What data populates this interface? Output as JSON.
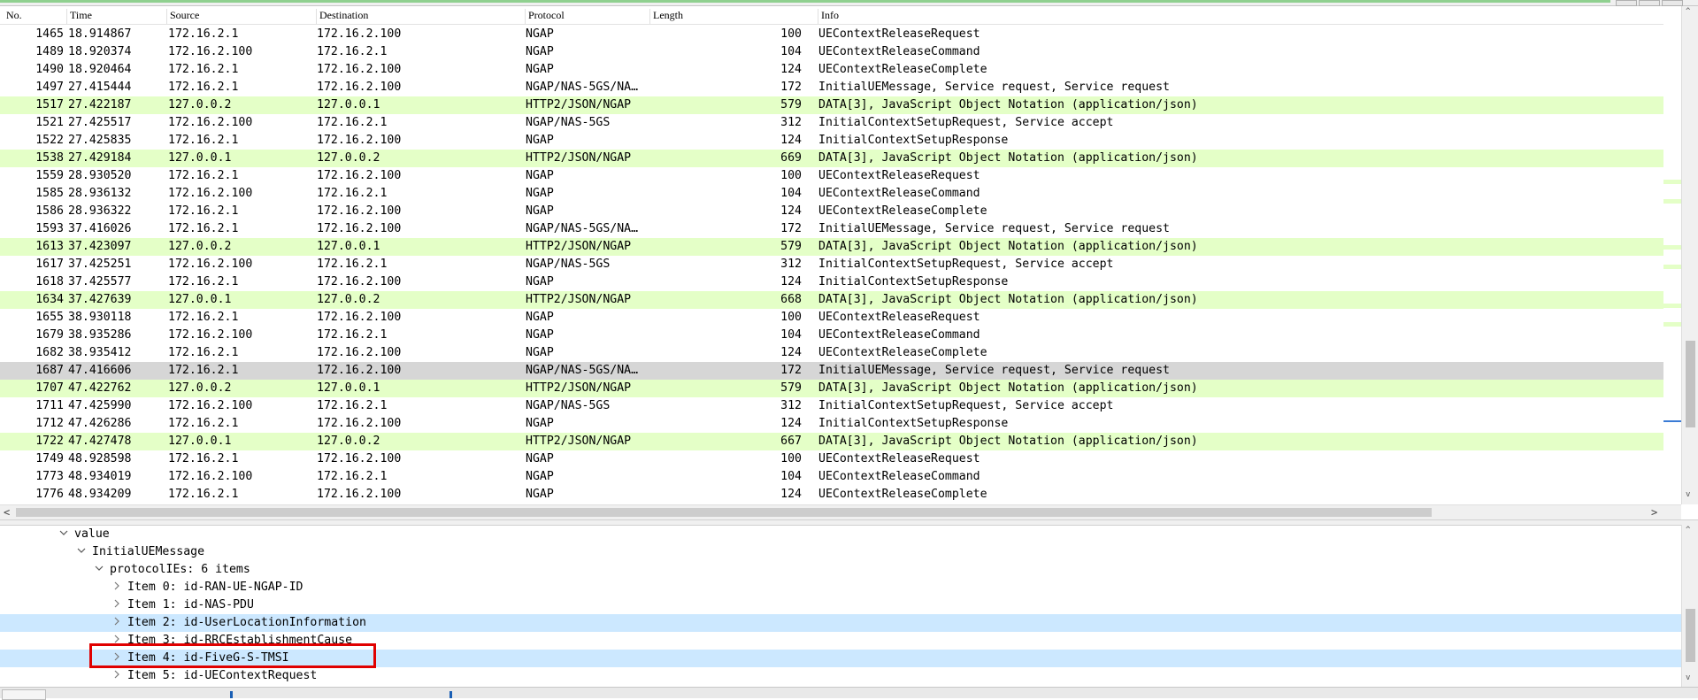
{
  "columns": {
    "no": "No.",
    "time": "Time",
    "source": "Source",
    "destination": "Destination",
    "protocol": "Protocol",
    "length": "Length",
    "info": "Info"
  },
  "packets": [
    {
      "no": "1465",
      "time": "18.914867",
      "src": "172.16.2.1",
      "dst": "172.16.2.100",
      "proto": "NGAP",
      "len": "100",
      "info": "UEContextReleaseRequest",
      "style": "normal"
    },
    {
      "no": "1489",
      "time": "18.920374",
      "src": "172.16.2.100",
      "dst": "172.16.2.1",
      "proto": "NGAP",
      "len": "104",
      "info": "UEContextReleaseCommand",
      "style": "normal"
    },
    {
      "no": "1490",
      "time": "18.920464",
      "src": "172.16.2.1",
      "dst": "172.16.2.100",
      "proto": "NGAP",
      "len": "124",
      "info": "UEContextReleaseComplete",
      "style": "normal"
    },
    {
      "no": "1497",
      "time": "27.415444",
      "src": "172.16.2.1",
      "dst": "172.16.2.100",
      "proto": "NGAP/NAS-5GS/NA…",
      "len": "172",
      "info": "InitialUEMessage, Service request, Service request",
      "style": "normal"
    },
    {
      "no": "1517",
      "time": "27.422187",
      "src": "127.0.0.2",
      "dst": "127.0.0.1",
      "proto": "HTTP2/JSON/NGAP",
      "len": "579",
      "info": "DATA[3], JavaScript Object Notation (application/json)",
      "style": "green"
    },
    {
      "no": "1521",
      "time": "27.425517",
      "src": "172.16.2.100",
      "dst": "172.16.2.1",
      "proto": "NGAP/NAS-5GS",
      "len": "312",
      "info": "InitialContextSetupRequest, Service accept",
      "style": "normal"
    },
    {
      "no": "1522",
      "time": "27.425835",
      "src": "172.16.2.1",
      "dst": "172.16.2.100",
      "proto": "NGAP",
      "len": "124",
      "info": "InitialContextSetupResponse",
      "style": "normal"
    },
    {
      "no": "1538",
      "time": "27.429184",
      "src": "127.0.0.1",
      "dst": "127.0.0.2",
      "proto": "HTTP2/JSON/NGAP",
      "len": "669",
      "info": "DATA[3], JavaScript Object Notation (application/json)",
      "style": "green"
    },
    {
      "no": "1559",
      "time": "28.930520",
      "src": "172.16.2.1",
      "dst": "172.16.2.100",
      "proto": "NGAP",
      "len": "100",
      "info": "UEContextReleaseRequest",
      "style": "normal"
    },
    {
      "no": "1585",
      "time": "28.936132",
      "src": "172.16.2.100",
      "dst": "172.16.2.1",
      "proto": "NGAP",
      "len": "104",
      "info": "UEContextReleaseCommand",
      "style": "normal"
    },
    {
      "no": "1586",
      "time": "28.936322",
      "src": "172.16.2.1",
      "dst": "172.16.2.100",
      "proto": "NGAP",
      "len": "124",
      "info": "UEContextReleaseComplete",
      "style": "normal"
    },
    {
      "no": "1593",
      "time": "37.416026",
      "src": "172.16.2.1",
      "dst": "172.16.2.100",
      "proto": "NGAP/NAS-5GS/NA…",
      "len": "172",
      "info": "InitialUEMessage, Service request, Service request",
      "style": "normal"
    },
    {
      "no": "1613",
      "time": "37.423097",
      "src": "127.0.0.2",
      "dst": "127.0.0.1",
      "proto": "HTTP2/JSON/NGAP",
      "len": "579",
      "info": "DATA[3], JavaScript Object Notation (application/json)",
      "style": "green"
    },
    {
      "no": "1617",
      "time": "37.425251",
      "src": "172.16.2.100",
      "dst": "172.16.2.1",
      "proto": "NGAP/NAS-5GS",
      "len": "312",
      "info": "InitialContextSetupRequest, Service accept",
      "style": "normal"
    },
    {
      "no": "1618",
      "time": "37.425577",
      "src": "172.16.2.1",
      "dst": "172.16.2.100",
      "proto": "NGAP",
      "len": "124",
      "info": "InitialContextSetupResponse",
      "style": "normal"
    },
    {
      "no": "1634",
      "time": "37.427639",
      "src": "127.0.0.1",
      "dst": "127.0.0.2",
      "proto": "HTTP2/JSON/NGAP",
      "len": "668",
      "info": "DATA[3], JavaScript Object Notation (application/json)",
      "style": "green"
    },
    {
      "no": "1655",
      "time": "38.930118",
      "src": "172.16.2.1",
      "dst": "172.16.2.100",
      "proto": "NGAP",
      "len": "100",
      "info": "UEContextReleaseRequest",
      "style": "normal"
    },
    {
      "no": "1679",
      "time": "38.935286",
      "src": "172.16.2.100",
      "dst": "172.16.2.1",
      "proto": "NGAP",
      "len": "104",
      "info": "UEContextReleaseCommand",
      "style": "normal"
    },
    {
      "no": "1682",
      "time": "38.935412",
      "src": "172.16.2.1",
      "dst": "172.16.2.100",
      "proto": "NGAP",
      "len": "124",
      "info": "UEContextReleaseComplete",
      "style": "normal"
    },
    {
      "no": "1687",
      "time": "47.416606",
      "src": "172.16.2.1",
      "dst": "172.16.2.100",
      "proto": "NGAP/NAS-5GS/NA…",
      "len": "172",
      "info": "InitialUEMessage, Service request, Service request",
      "style": "selected"
    },
    {
      "no": "1707",
      "time": "47.422762",
      "src": "127.0.0.2",
      "dst": "127.0.0.1",
      "proto": "HTTP2/JSON/NGAP",
      "len": "579",
      "info": "DATA[3], JavaScript Object Notation (application/json)",
      "style": "green"
    },
    {
      "no": "1711",
      "time": "47.425990",
      "src": "172.16.2.100",
      "dst": "172.16.2.1",
      "proto": "NGAP/NAS-5GS",
      "len": "312",
      "info": "InitialContextSetupRequest, Service accept",
      "style": "normal"
    },
    {
      "no": "1712",
      "time": "47.426286",
      "src": "172.16.2.1",
      "dst": "172.16.2.100",
      "proto": "NGAP",
      "len": "124",
      "info": "InitialContextSetupResponse",
      "style": "normal"
    },
    {
      "no": "1722",
      "time": "47.427478",
      "src": "127.0.0.1",
      "dst": "127.0.0.2",
      "proto": "HTTP2/JSON/NGAP",
      "len": "667",
      "info": "DATA[3], JavaScript Object Notation (application/json)",
      "style": "green"
    },
    {
      "no": "1749",
      "time": "48.928598",
      "src": "172.16.2.1",
      "dst": "172.16.2.100",
      "proto": "NGAP",
      "len": "100",
      "info": "UEContextReleaseRequest",
      "style": "normal"
    },
    {
      "no": "1773",
      "time": "48.934019",
      "src": "172.16.2.100",
      "dst": "172.16.2.1",
      "proto": "NGAP",
      "len": "104",
      "info": "UEContextReleaseCommand",
      "style": "normal"
    },
    {
      "no": "1776",
      "time": "48.934209",
      "src": "172.16.2.1",
      "dst": "172.16.2.100",
      "proto": "NGAP",
      "len": "124",
      "info": "UEContextReleaseComplete",
      "style": "normal"
    }
  ],
  "tree": [
    {
      "label": "value",
      "depth": 0,
      "toggle": "expanded",
      "highlight": false
    },
    {
      "label": "InitialUEMessage",
      "depth": 1,
      "toggle": "expanded",
      "highlight": false
    },
    {
      "label": "protocolIEs: 6 items",
      "depth": 2,
      "toggle": "expanded",
      "highlight": false
    },
    {
      "label": "Item 0: id-RAN-UE-NGAP-ID",
      "depth": 3,
      "toggle": "collapsed",
      "highlight": false
    },
    {
      "label": "Item 1: id-NAS-PDU",
      "depth": 3,
      "toggle": "collapsed",
      "highlight": false
    },
    {
      "label": "Item 2: id-UserLocationInformation",
      "depth": 3,
      "toggle": "collapsed",
      "highlight": true
    },
    {
      "label": "Item 3: id-RRCEstablishmentCause",
      "depth": 3,
      "toggle": "collapsed",
      "highlight": false
    },
    {
      "label": "Item 4: id-FiveG-S-TMSI",
      "depth": 3,
      "toggle": "collapsed",
      "highlight": true
    },
    {
      "label": "Item 5: id-UEContextRequest",
      "depth": 3,
      "toggle": "collapsed",
      "highlight": false
    }
  ],
  "icons": {
    "expanded": "chevron-down-icon",
    "collapsed": "chevron-right-icon"
  },
  "colors": {
    "green_row": "#e4ffc7",
    "selected_row": "#d6d6d6",
    "highlight_row": "#cce8ff",
    "annotation_box": "#e00000"
  },
  "scroll_glyphs": {
    "left": "<",
    "right": ">",
    "up": "^",
    "down": "v"
  }
}
